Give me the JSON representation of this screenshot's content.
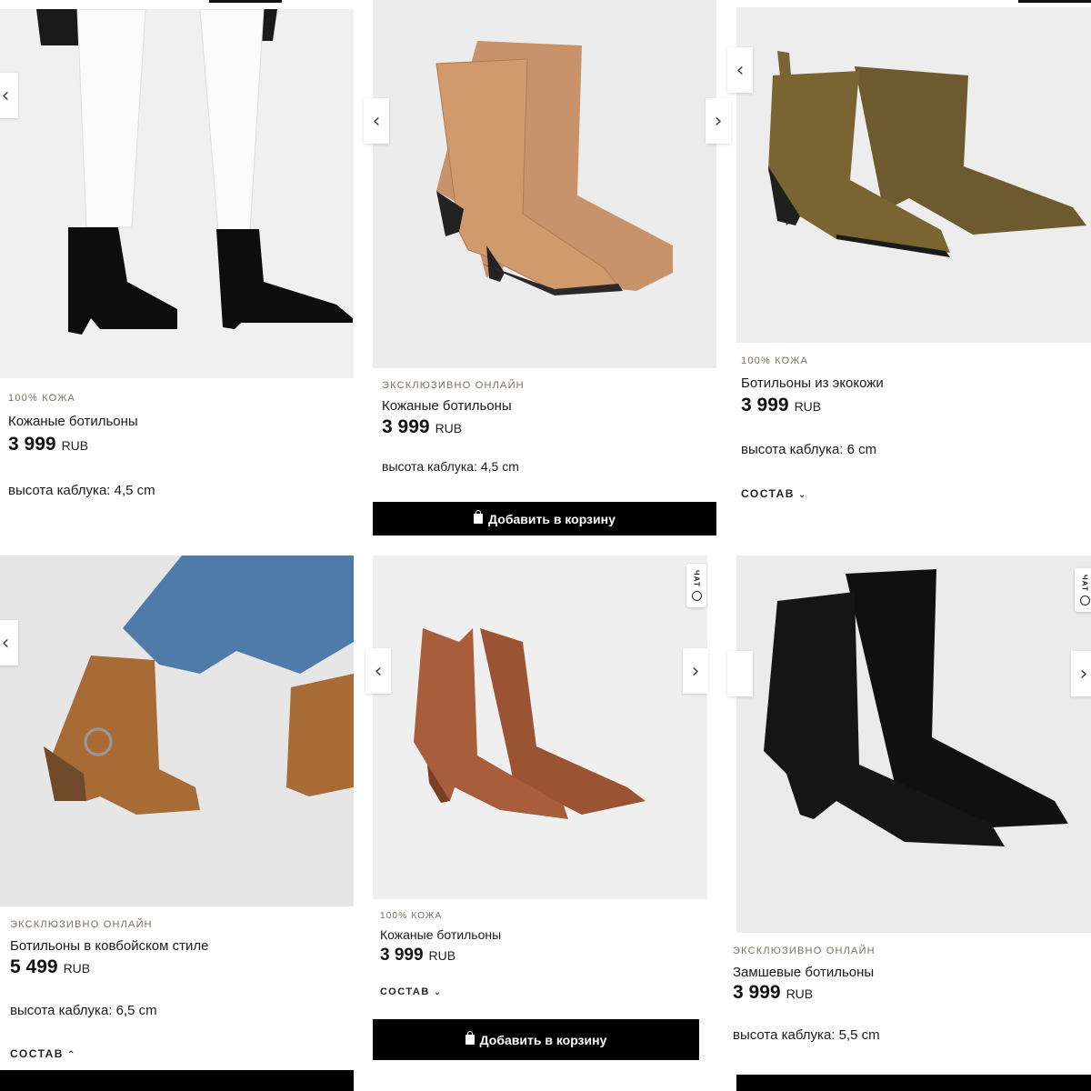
{
  "colors": {
    "button_bg": "#000000",
    "tag_color": "#7a6f63"
  },
  "add_to_cart_label": "Добавить в корзину",
  "chat_label": "ЧАТ",
  "icons": {
    "prev": "chevron-left-icon",
    "next": "chevron-right-icon",
    "bag": "shopping-bag-icon"
  },
  "products": [
    {
      "tag": "100% КОЖА",
      "name": "Кожаные ботильоны",
      "price": "3 999",
      "currency": "RUB",
      "heel": "высота каблука: 4,5 cm"
    },
    {
      "tag": "ЭКСКЛЮЗИВНО ОНЛАЙН",
      "name": "Кожаные ботильоны",
      "price": "3 999",
      "currency": "RUB",
      "heel": "высота каблука: 4,5 cm"
    },
    {
      "tag": "100% КОЖА",
      "name": "Ботильоны из экокожи",
      "price": "3 999",
      "currency": "RUB",
      "heel": "высота каблука: 6 cm",
      "sostav": "СОСТАВ"
    },
    {
      "tag": "ЭКСКЛЮЗИВНО ОНЛАЙН",
      "name": "Ботильоны в ковбойском стиле",
      "price": "5 499",
      "currency": "RUB",
      "heel": "высота каблука: 6,5 cm",
      "sostav": "СОСТАВ"
    },
    {
      "tag": "100% КОЖА",
      "name": "Кожаные ботильоны",
      "price": "3 999",
      "currency": "RUB",
      "sostav": "СОСТАВ"
    },
    {
      "tag": "ЭКСКЛЮЗИВНО ОНЛАЙН",
      "name": "Замшевые ботильоны",
      "price": "3 999",
      "currency": "RUB",
      "heel": "высота каблука: 5,5 cm"
    }
  ]
}
